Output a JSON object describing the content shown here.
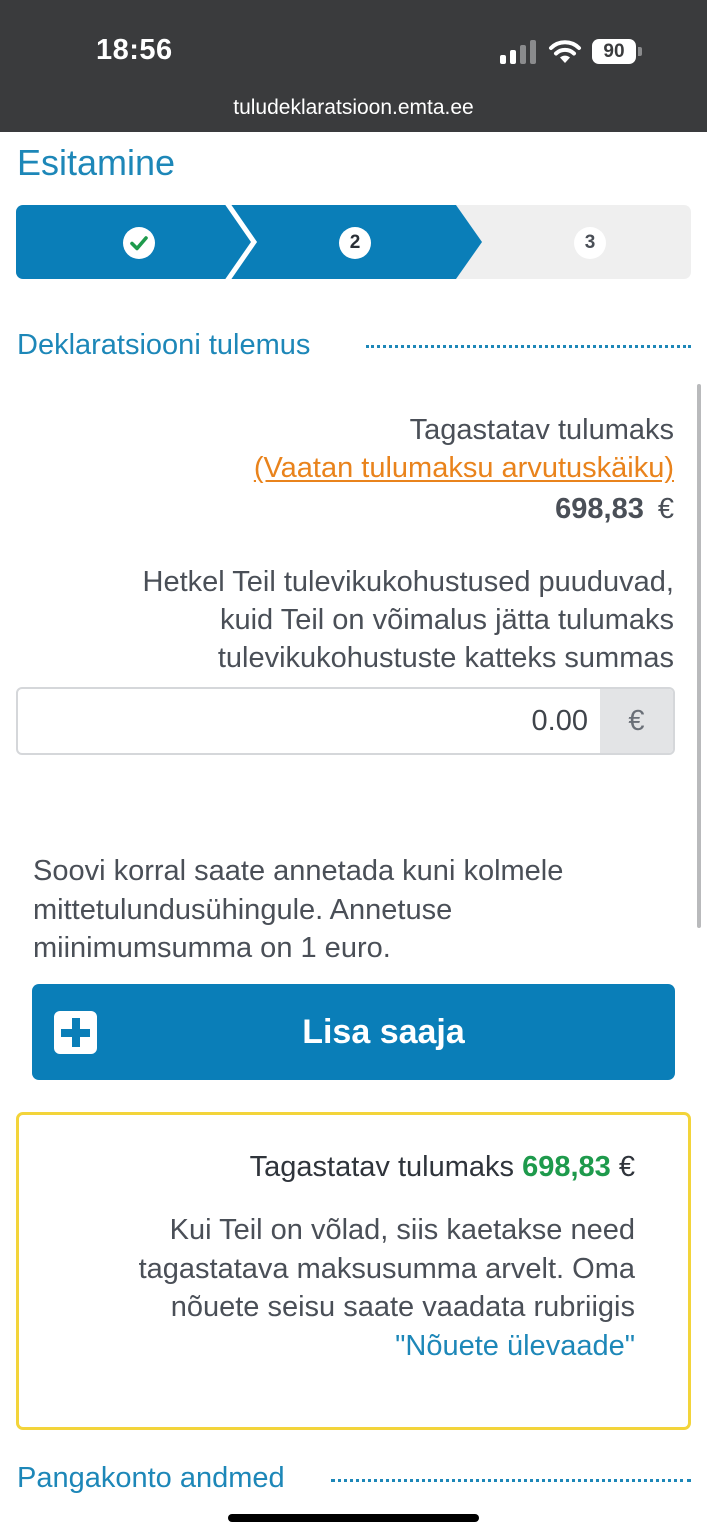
{
  "status_bar": {
    "time": "18:56",
    "battery": "90",
    "url": "tuludeklaratsioon.emta.ee"
  },
  "page_title": "Esitamine",
  "stepper": {
    "steps": [
      {
        "label": "",
        "state": "done",
        "icon": "check-icon"
      },
      {
        "label": "2",
        "state": "current"
      },
      {
        "label": "3",
        "state": "upcoming"
      }
    ],
    "active_color": "#0a7eb8"
  },
  "result_section": {
    "heading": "Deklaratsiooni tulemus",
    "refund_label": "Tagastatav tulumaks",
    "calc_link": "(Vaatan tulumaksu arvutuskäiku)",
    "refund_amount": "698,83",
    "currency": "€",
    "future_obligations_lines": [
      "Hetkel Teil tulevikukohustused puuduvad,",
      "kuid Teil on võimalus jätta tulumaks",
      "tulevikukohustuste katteks summas"
    ],
    "amount_input_value": "0.00",
    "amount_input_addon": "€",
    "donation_text": "Soovi korral saate annetada kuni kolmele mittetulundusühingule. Annetuse miinimumsumma on 1 euro.",
    "add_recipient_label": "Lisa saaja"
  },
  "notice": {
    "label": "Tagastatav tulumaks",
    "amount": "698,83",
    "currency": "€",
    "body_lines": [
      "Kui Teil on võlad, siis kaetakse need",
      "tagastatava maksusumma arvelt. Oma",
      "nõuete seisu saate vaadata rubriigis"
    ],
    "link": "\"Nõuete ülevaade\"",
    "border_color": "#f3d43a",
    "amount_color": "#1e9a4c"
  },
  "bank_section": {
    "heading": "Pangakonto andmed"
  },
  "colors": {
    "brand_blue": "#1d87b8",
    "link_orange": "#e9831c"
  }
}
